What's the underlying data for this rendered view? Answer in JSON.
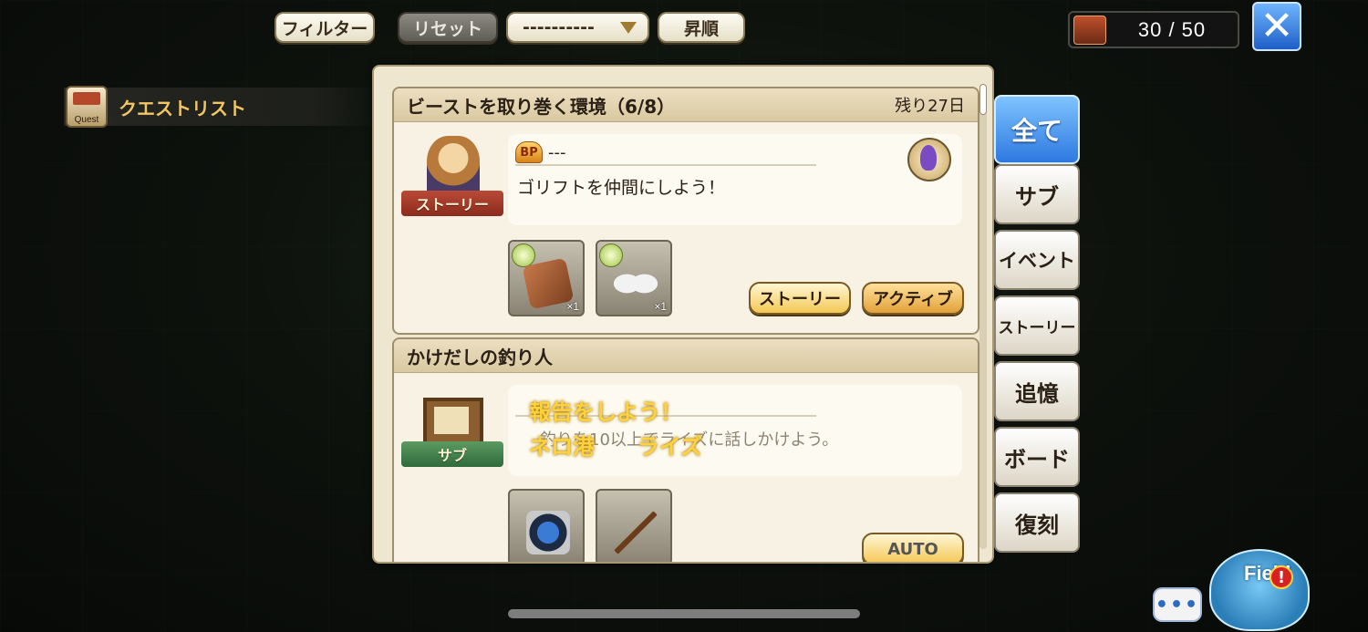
{
  "toolbar": {
    "filter_label": "フィルター",
    "reset_label": "リセット",
    "sort_value": "----------",
    "order_label": "昇順"
  },
  "counter": {
    "value": "30 / 50",
    "icon": "shop-icon"
  },
  "close": {
    "icon": "close-x-icon",
    "glyph": "✕"
  },
  "sidebar": {
    "title": "クエストリスト",
    "icon_label": "Quest"
  },
  "quests": [
    {
      "title": "ビーストを取り巻く環境（6/8）",
      "remaining": "残り27日",
      "category_label": "ストーリー",
      "bp_badge": "BP",
      "bp_value": "---",
      "description": "ゴリフトを仲間にしよう！",
      "rewards": [
        {
          "icon": "tablet-item-icon",
          "qty": "×1"
        },
        {
          "icon": "rabbit-ears-item-icon",
          "qty": "×1"
        }
      ],
      "buttons": {
        "story": "ストーリー",
        "active": "アクティブ"
      }
    },
    {
      "title": "かけだしの釣り人",
      "category_label": "サブ",
      "notice_line1": "報告をしよう！",
      "notice_line2_a": "ネロ港",
      "notice_line2_b": "ライズ",
      "description_faded": "釣りを10以上でライズに話しかけよう。",
      "rewards": [
        {
          "icon": "fish-shield-item-icon"
        },
        {
          "icon": "fishing-rod-item-icon"
        }
      ],
      "buttons": {
        "auto": "AUTO"
      }
    }
  ],
  "tabs": {
    "all": "全て",
    "sub": "サブ",
    "event": "イベント",
    "story": "ストーリー",
    "memory": "追憶",
    "board": "ボード",
    "reissue": "復刻"
  },
  "field": {
    "label": "Field",
    "alert": "!",
    "chat_glyph": "•••"
  }
}
